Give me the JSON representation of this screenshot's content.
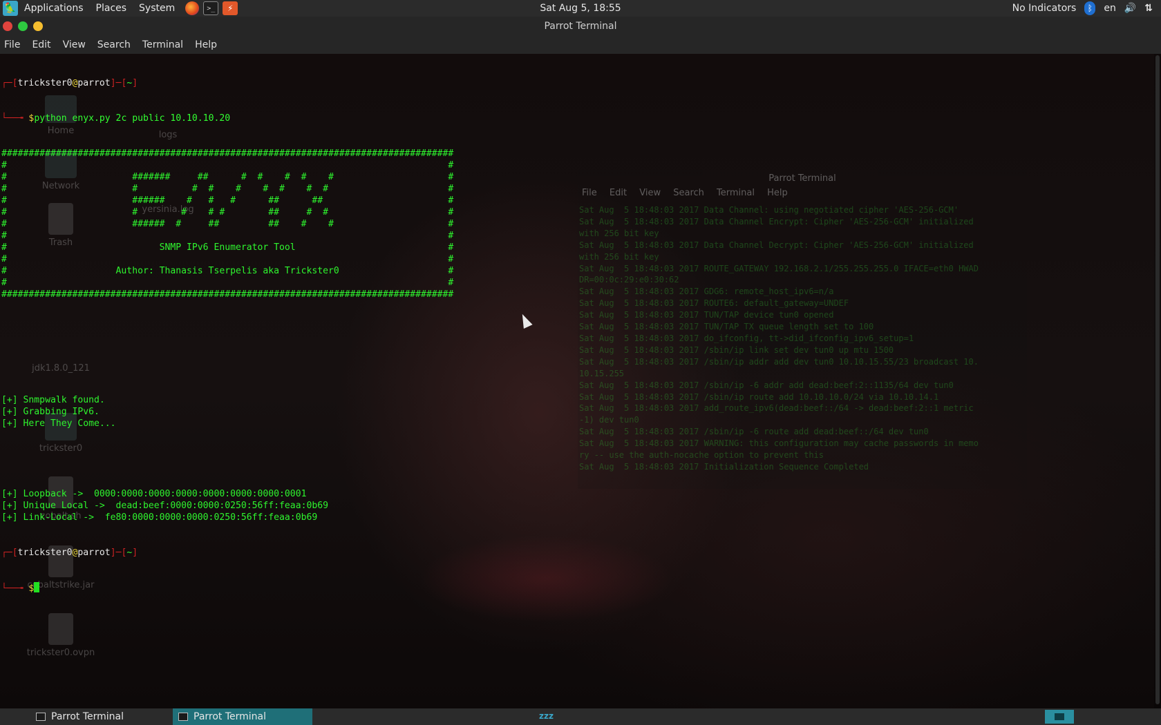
{
  "top_panel": {
    "menus": [
      "Applications",
      "Places",
      "System"
    ],
    "clock": "Sat Aug  5, 18:55",
    "indicators_label": "No Indicators",
    "keyboard_layout": "en"
  },
  "window": {
    "title": "Parrot Terminal",
    "menu": [
      "File",
      "Edit",
      "View",
      "Search",
      "Terminal",
      "Help"
    ]
  },
  "terminal": {
    "user": "trickster0",
    "host": "parrot",
    "cwd": "~",
    "command": "python enyx.py 2c public 10.10.10.20",
    "banner": [
      "###################################################################################",
      "#                                                                                 #",
      "#                       #######     ##      #  #    #  #    #                     #",
      "#                       #          #  #    #    #  #    #  #                      #",
      "#                       ######    #   #   #      ##      ##                       #",
      "#                       #        #    # #        ##     #  #                      #",
      "#                       ######  #     ##         ##    #    #                     #",
      "#                                                                                 #",
      "#                            SNMP IPv6 Enumerator Tool                            #",
      "#                                                                                 #",
      "#                    Author: Thanasis Tserpelis aka Trickster0                    #",
      "#                                                                                 #",
      "###################################################################################"
    ],
    "status_lines": [
      "[+] Snmpwalk found.",
      "[+] Grabbing IPv6.",
      "[+] Here They Come..."
    ],
    "addresses": [
      {
        "label": "[+] Loopback ->  ",
        "value": "0000:0000:0000:0000:0000:0000:0000:0001"
      },
      {
        "label": "[+] Unique Local ->  ",
        "value": "dead:beef:0000:0000:0250:56ff:feaa:0b69"
      },
      {
        "label": "[+] Link-Local ->  ",
        "value": "fe80:0000:0000:0000:0250:56ff:feaa:0b69"
      }
    ]
  },
  "desktop_icons": [
    "Home",
    "logs",
    "Network",
    "yersinia.log",
    "Trash",
    "jdk1.8.0_121",
    "trickster0",
    "cobalt.sh",
    "cobaltstrike.jar",
    "trickster0.ovpn"
  ],
  "background_terminal": {
    "title": "Parrot Terminal",
    "menu": [
      "File",
      "Edit",
      "View",
      "Search",
      "Terminal",
      "Help"
    ],
    "log": [
      "Sat Aug  5 18:48:03 2017 Data Channel: using negotiated cipher 'AES-256-GCM'",
      "Sat Aug  5 18:48:03 2017 Data Channel Encrypt: Cipher 'AES-256-GCM' initialized",
      "with 256 bit key",
      "Sat Aug  5 18:48:03 2017 Data Channel Decrypt: Cipher 'AES-256-GCM' initialized",
      "with 256 bit key",
      "Sat Aug  5 18:48:03 2017 ROUTE_GATEWAY 192.168.2.1/255.255.255.0 IFACE=eth0 HWAD",
      "DR=00:0c:29:e0:30:62",
      "Sat Aug  5 18:48:03 2017 GDG6: remote_host_ipv6=n/a",
      "Sat Aug  5 18:48:03 2017 ROUTE6: default_gateway=UNDEF",
      "Sat Aug  5 18:48:03 2017 TUN/TAP device tun0 opened",
      "Sat Aug  5 18:48:03 2017 TUN/TAP TX queue length set to 100",
      "Sat Aug  5 18:48:03 2017 do_ifconfig, tt->did_ifconfig_ipv6_setup=1",
      "Sat Aug  5 18:48:03 2017 /sbin/ip link set dev tun0 up mtu 1500",
      "Sat Aug  5 18:48:03 2017 /sbin/ip addr add dev tun0 10.10.15.55/23 broadcast 10.",
      "10.15.255",
      "Sat Aug  5 18:48:03 2017 /sbin/ip -6 addr add dead:beef:2::1135/64 dev tun0",
      "Sat Aug  5 18:48:03 2017 /sbin/ip route add 10.10.10.0/24 via 10.10.14.1",
      "Sat Aug  5 18:48:03 2017 add_route_ipv6(dead:beef::/64 -> dead:beef:2::1 metric",
      "-1) dev tun0",
      "Sat Aug  5 18:48:03 2017 /sbin/ip -6 route add dead:beef::/64 dev tun0",
      "Sat Aug  5 18:48:03 2017 WARNING: this configuration may cache passwords in memo",
      "ry -- use the auth-nocache option to prevent this",
      "Sat Aug  5 18:48:03 2017 Initialization Sequence Completed"
    ]
  },
  "taskbar": {
    "tasks": [
      "Parrot Terminal",
      "Parrot Terminal"
    ],
    "sleep_indicator": "zzz"
  },
  "colors": {
    "prompt_bracket": "#cc2222",
    "prompt_text": "#e8e8e8",
    "prompt_symbol": "#e6d33a",
    "output": "#2ef52e",
    "panel": "#2b2b2b",
    "task_active": "#1f6f78"
  }
}
